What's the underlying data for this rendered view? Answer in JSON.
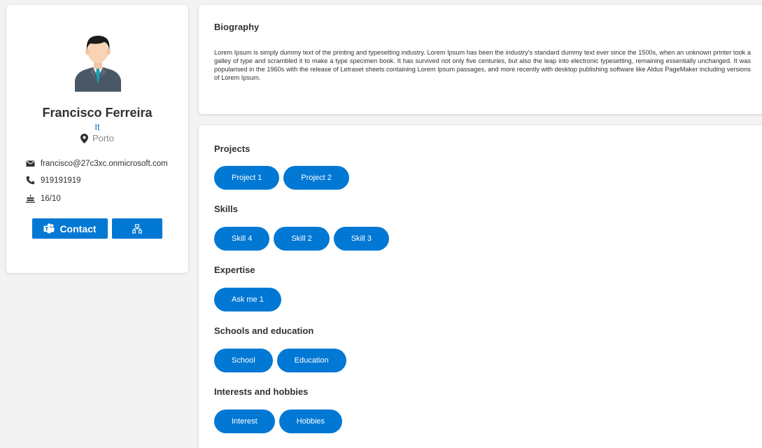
{
  "profile": {
    "name": "Francisco Ferreira",
    "department": "It",
    "location": "Porto",
    "email": "francisco@27c3xc.onmicrosoft.com",
    "phone": "919191919",
    "date": "16/10",
    "contact_label": "Contact",
    "icons": {
      "location": "map-pin-icon",
      "email": "envelope-icon",
      "phone": "phone-icon",
      "date": "cake-icon",
      "contact": "teams-icon",
      "org": "org-chart-icon"
    }
  },
  "biography": {
    "title": "Biography",
    "text": "Lorem Ipsum is simply dummy text of the printing and typesetting industry. Lorem Ipsum has been the industry's standard dummy text ever since the 1500s, when an unknown printer took a galley of type and scrambled it to make a type specimen book. It has survived not only five centuries, but also the leap into electronic typesetting, remaining essentially unchanged. It was popularised in the 1960s with the release of Letraset sheets containing Lorem Ipsum passages, and more recently with desktop publishing software like Aldus PageMaker including versions of Lorem Ipsum."
  },
  "sections": [
    {
      "title": "Projects",
      "items": [
        "Project 1",
        "Project 2"
      ]
    },
    {
      "title": "Skills",
      "items": [
        "Skill 4",
        "Skill 2",
        "Skill 3"
      ]
    },
    {
      "title": "Expertise",
      "items": [
        "Ask me 1"
      ]
    },
    {
      "title": "Schools and education",
      "items": [
        "School",
        "Education"
      ]
    },
    {
      "title": "Interests and hobbies",
      "items": [
        "Interest",
        "Hobbies"
      ]
    }
  ],
  "colors": {
    "accent": "#0078d4",
    "background": "#f3f3f3",
    "card": "#ffffff",
    "text": "#323130",
    "muted": "#8a8886"
  }
}
